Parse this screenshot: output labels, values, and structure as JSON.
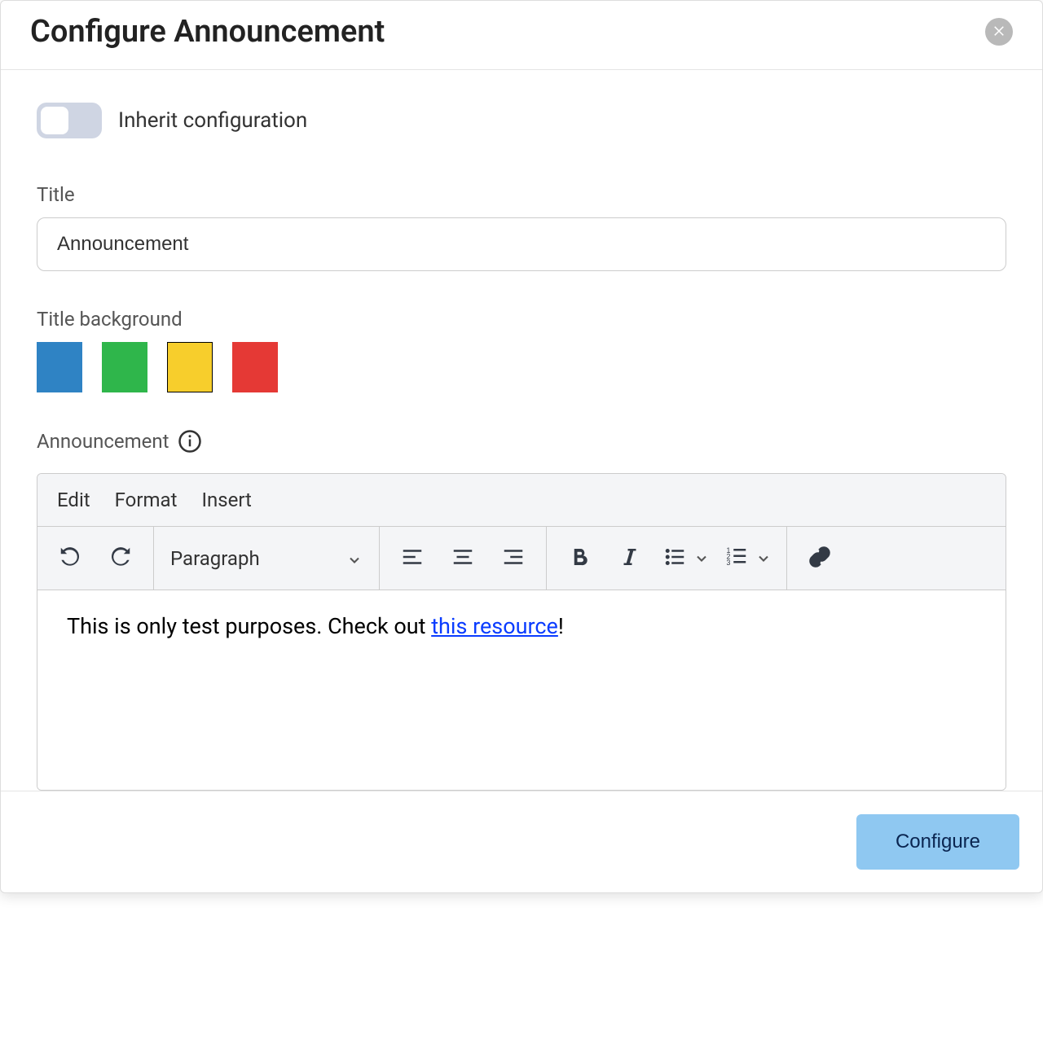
{
  "modal": {
    "title": "Configure Announcement",
    "inherit_label": "Inherit configuration",
    "title_field_label": "Title",
    "title_value": "Announcement",
    "title_bg_label": "Title background",
    "colors": {
      "blue": "#2f83c4",
      "green": "#2fb64b",
      "yellow": "#f7ce2c",
      "red": "#e53935"
    },
    "selected_color_index": 2,
    "announcement_label": "Announcement"
  },
  "editor": {
    "menu": {
      "edit": "Edit",
      "format": "Format",
      "insert": "Insert"
    },
    "format_select": "Paragraph",
    "content_before": "This is only test purposes. Check out ",
    "content_link": "this resource",
    "content_after": "!"
  },
  "footer": {
    "configure_label": "Configure"
  }
}
